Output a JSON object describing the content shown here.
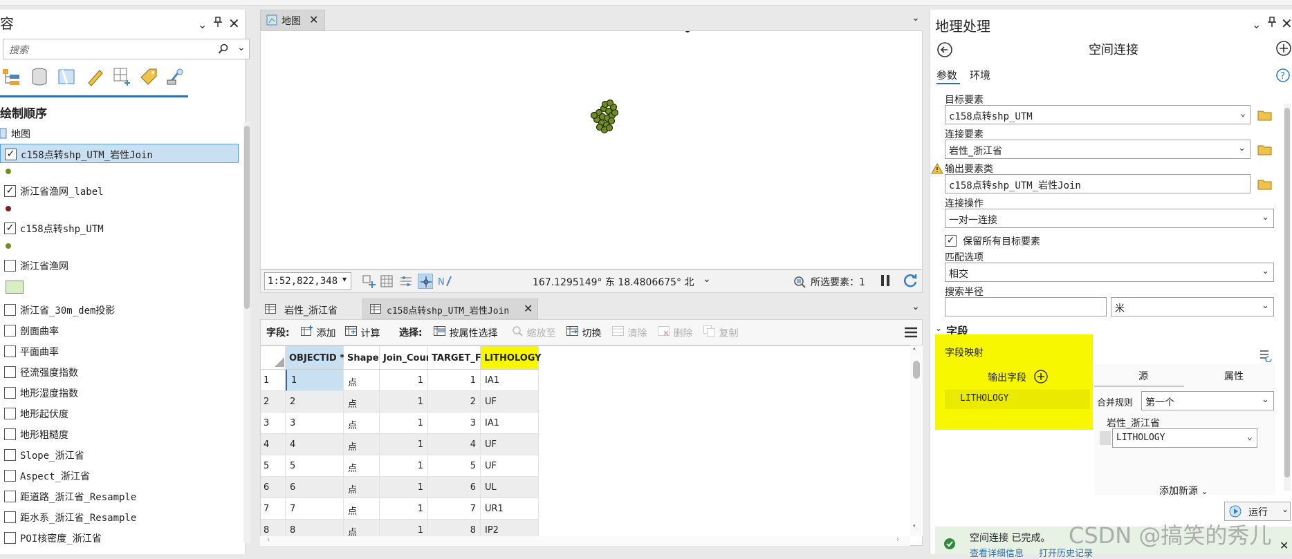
{
  "contents": {
    "title": "容",
    "search_placeholder": "搜索",
    "heading": "绘制顺序",
    "map_label": "地图",
    "layers": [
      {
        "label": "c158点转shp_UTM_岩性Join",
        "checked": true,
        "selected": true
      },
      {
        "label": "浙江省渔网_label",
        "checked": true
      },
      {
        "label": "c158点转shp_UTM",
        "checked": true
      },
      {
        "label": "浙江省渔网",
        "checked": false
      },
      {
        "label": "浙江省_30m_dem投影",
        "checked": false
      },
      {
        "label": "剖面曲率",
        "checked": false
      },
      {
        "label": "平面曲率",
        "checked": false
      },
      {
        "label": "径流强度指数",
        "checked": false
      },
      {
        "label": "地形湿度指数",
        "checked": false
      },
      {
        "label": "地形起伏度",
        "checked": false
      },
      {
        "label": "地形粗糙度",
        "checked": false
      },
      {
        "label": "Slope_浙江省",
        "checked": false
      },
      {
        "label": "Aspect_浙江省",
        "checked": false
      },
      {
        "label": "距道路_浙江省_Resample",
        "checked": false
      },
      {
        "label": "距水系_浙江省_Resample",
        "checked": false
      },
      {
        "label": "POI核密度_浙江省",
        "checked": false
      }
    ]
  },
  "map": {
    "tab_label": "地图",
    "scale": "1:52,822,348",
    "coordinates": "167.1295149° 东 18.4806675° 北",
    "selected_features": "所选要素：1"
  },
  "table": {
    "tabs": [
      "岩性_浙江省",
      "c158点转shp_UTM_岩性Join"
    ],
    "toolbar": {
      "field_label": "字段:",
      "add": "添加",
      "calculate": "计算",
      "select_label": "选择:",
      "select_by_attr": "按属性选择",
      "zoom_to": "缩放至",
      "switch": "切换",
      "clear": "清除",
      "delete": "删除",
      "copy": "复制"
    },
    "columns": [
      "OBJECTID *",
      "Shape *",
      "Join_Count",
      "TARGET_FID",
      "LITHOLOGY"
    ],
    "rows": [
      [
        "1",
        "1",
        "点",
        "1",
        "1",
        "IA1"
      ],
      [
        "2",
        "2",
        "点",
        "1",
        "2",
        "UF"
      ],
      [
        "3",
        "3",
        "点",
        "1",
        "3",
        "IA1"
      ],
      [
        "4",
        "4",
        "点",
        "1",
        "4",
        "UF"
      ],
      [
        "5",
        "5",
        "点",
        "1",
        "5",
        "UF"
      ],
      [
        "6",
        "6",
        "点",
        "1",
        "6",
        "UL"
      ],
      [
        "7",
        "7",
        "点",
        "1",
        "7",
        "UR1"
      ],
      [
        "8",
        "8",
        "点",
        "1",
        "8",
        "IP2"
      ]
    ]
  },
  "gp": {
    "title": "地理处理",
    "tool_title": "空间连接",
    "tab_params": "参数",
    "tab_env": "环境",
    "target_label": "目标要素",
    "target_value": "c158点转shp_UTM",
    "join_label": "连接要素",
    "join_value": "岩性_浙江省",
    "output_label": "输出要素类",
    "output_value": "c158点转shp_UTM_岩性Join",
    "operation_label": "连接操作",
    "operation_value": "一对一连接",
    "keep_all_label": "保留所有目标要素",
    "match_label": "匹配选项",
    "match_value": "相交",
    "radius_label": "搜索半径",
    "radius_value": "",
    "radius_unit": "米",
    "fields_section": "字段",
    "field_map_label": "字段映射",
    "output_fields_label": "输出字段",
    "field_item": "LITHOLOGY",
    "source_tab": "源",
    "property_tab": "属性",
    "merge_rule_label": "合并规则",
    "merge_rule_value": "第一个",
    "source_layer": "岩性_浙江省",
    "source_field": "LITHOLOGY",
    "add_source": "添加新源",
    "run": "运行",
    "status": "空间连接 已完成。",
    "status_link": "查看详细信息",
    "status_link2": "打开历史记录"
  },
  "watermark": "CSDN @搞笑的秀儿",
  "colors": {
    "highlight": "#f7f700",
    "accent": "#2f6ea8",
    "selected_row": "#c9dff2",
    "points": "#6f8e1f"
  }
}
